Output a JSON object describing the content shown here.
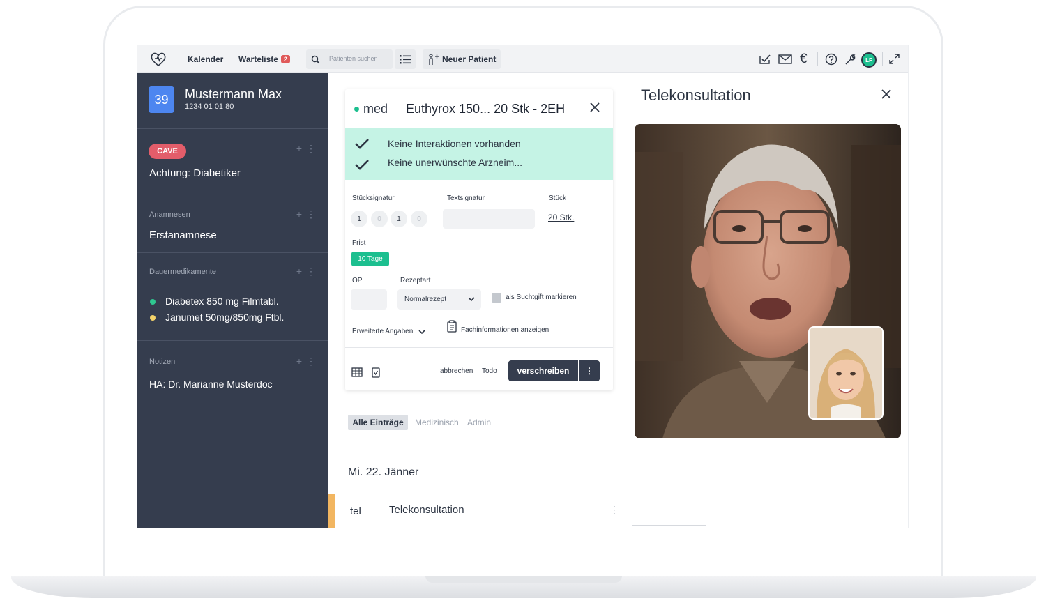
{
  "topbar": {
    "calendar_label": "Kalender",
    "waitlist_label": "Warteliste",
    "waitlist_count": "2",
    "search_placeholder": "Patienten suchen",
    "new_patient_label": "Neuer Patient",
    "avatar_initials": "LF"
  },
  "patient": {
    "number": "39",
    "name": "Mustermann Max",
    "id": "1234 01 01 80"
  },
  "sidebar": {
    "cave_badge": "CAVE",
    "cave_text": "Achtung: Diabetiker",
    "anamnesis_title": "Anamnesen",
    "anamnesis_text": "Erstanamnese",
    "longterm_title": "Dauermedikamente",
    "medications": [
      {
        "name": "Diabetex 850 mg Filmtabl.",
        "color": "#2fc790"
      },
      {
        "name": "Janumet 50mg/850mg Ftbl.",
        "color": "#f4d36a"
      }
    ],
    "notes_title": "Notizen",
    "notes_text": "HA: Dr. Marianne Musterdoc"
  },
  "prescription": {
    "type": "med",
    "title": "Euthyrox 150... 20 Stk - 2EH",
    "checks": [
      "Keine Interaktionen vorhanden",
      "Keine unerwünschte Arzneim..."
    ],
    "piece_signature_label": "Stücksignatur",
    "piece_signature_values": [
      "1",
      "0",
      "1",
      "0"
    ],
    "text_signature_label": "Textsignatur",
    "quantity_label": "Stück",
    "quantity_value": "20 Stk.",
    "deadline_label": "Frist",
    "deadline_value": "10 Tage",
    "op_label": "OP",
    "rx_type_label": "Rezeptart",
    "rx_type_value": "Normalrezept",
    "narcotic_label": "als Suchtgift markieren",
    "extended_label": "Erweiterte Angaben",
    "fachinfo_label": "Fachinformationen anzeigen",
    "cancel_label": "abbrechen",
    "todo_label": "Todo",
    "prescribe_label": "verschreiben"
  },
  "filters": {
    "all": "Alle Einträge",
    "medical": "Medizinisch",
    "admin": "Admin"
  },
  "timeline": {
    "date": "Mi. 22. Jänner",
    "entry_type": "tel",
    "entry_title": "Telekonsultation"
  },
  "teleconsult": {
    "title": "Telekonsultation"
  },
  "colors": {
    "sidebar": "#353d4e",
    "accent_green": "#1cbf8f",
    "cave_red": "#e35d6a",
    "number_blue": "#4d86f0",
    "timeline_accent": "#f2b661"
  }
}
